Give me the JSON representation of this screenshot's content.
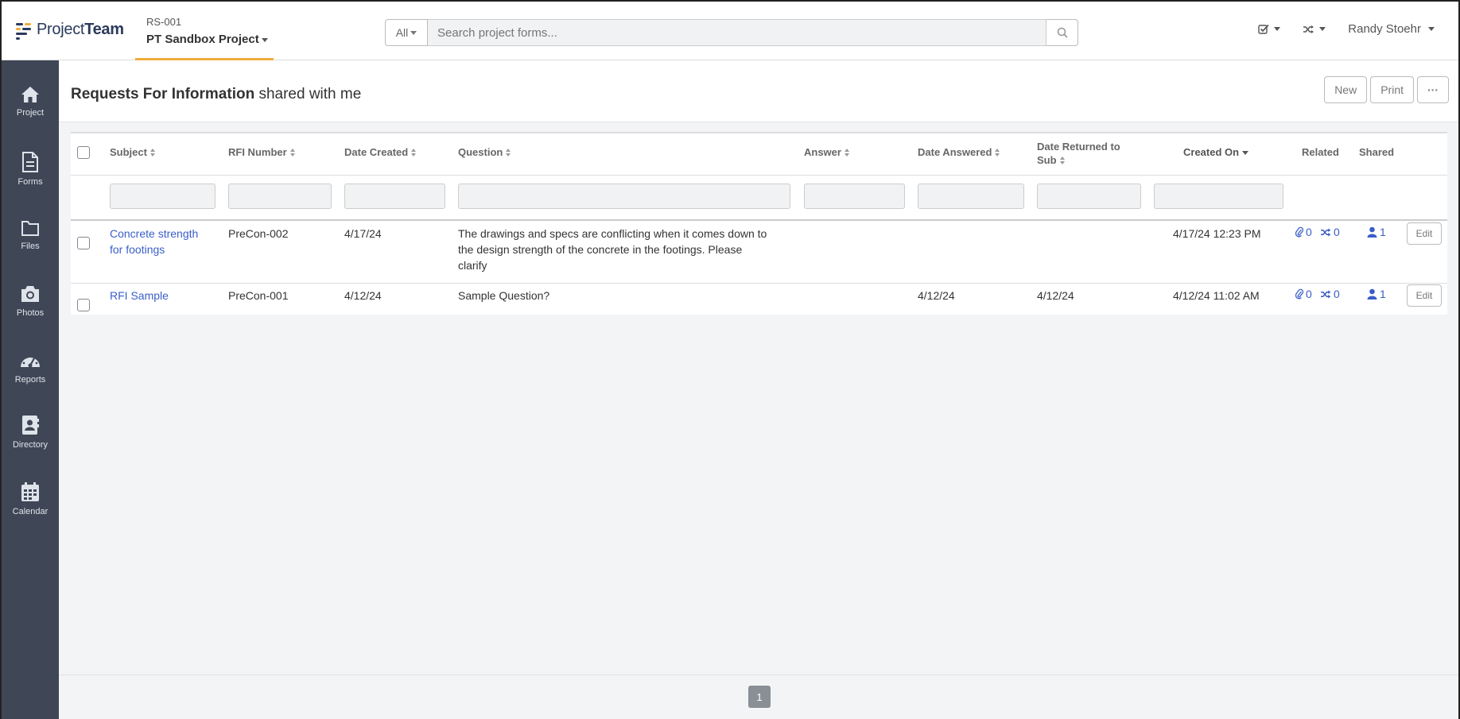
{
  "app": {
    "logo_regular": "Project",
    "logo_bold": "Team"
  },
  "project": {
    "code": "RS-001",
    "name": "PT Sandbox Project"
  },
  "search": {
    "scope": "All",
    "placeholder": "Search project forms..."
  },
  "user": {
    "name": "Randy Stoehr"
  },
  "sidebar": {
    "items": [
      {
        "label": "Project",
        "icon": "home-icon"
      },
      {
        "label": "Forms",
        "icon": "document-icon"
      },
      {
        "label": "Files",
        "icon": "folder-icon"
      },
      {
        "label": "Photos",
        "icon": "camera-icon"
      },
      {
        "label": "Reports",
        "icon": "dashboard-icon"
      },
      {
        "label": "Directory",
        "icon": "address-book-icon"
      },
      {
        "label": "Calendar",
        "icon": "calendar-icon"
      }
    ]
  },
  "page": {
    "title_bold": "Requests For Information",
    "title_rest": " shared with me"
  },
  "actions": {
    "new": "New",
    "print": "Print",
    "more": "···"
  },
  "table": {
    "columns": {
      "subject": "Subject",
      "rfi_number": "RFI Number",
      "date_created": "Date Created",
      "question": "Question",
      "answer": "Answer",
      "date_answered": "Date Answered",
      "date_returned_1": "Date Returned to",
      "date_returned_2": "Sub",
      "created_on": "Created On",
      "related": "Related",
      "shared": "Shared"
    },
    "rows": [
      {
        "subject_1": "Concrete strength",
        "subject_2": "for footings",
        "rfi_number": "PreCon-002",
        "date_created": "4/17/24",
        "question_1": "The drawings and specs are conflicting when it comes down to",
        "question_2": "the design strength of the concrete in the footings. Please",
        "question_3": "clarify",
        "answer": "",
        "date_answered": "",
        "date_returned": "",
        "created_on": "4/17/24 12:23 PM",
        "attachments": "0",
        "links": "0",
        "shared": "1",
        "edit": "Edit"
      },
      {
        "subject_1": "RFI Sample",
        "rfi_number": "PreCon-001",
        "date_created": "4/12/24",
        "question_1": "Sample Question?",
        "answer": "",
        "date_answered": "4/12/24",
        "date_returned": "4/12/24",
        "created_on": "4/12/24 11:02 AM",
        "attachments": "0",
        "links": "0",
        "shared": "1",
        "edit": "Edit"
      }
    ]
  },
  "pagination": {
    "current": "1"
  },
  "colors": {
    "accent": "#f0ad3c",
    "link": "#3a5ec9",
    "sidebar": "#3f4756"
  }
}
